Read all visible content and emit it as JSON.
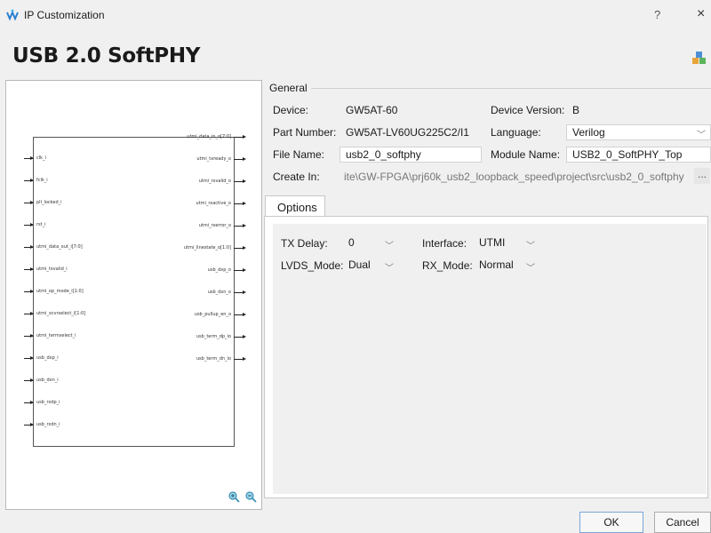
{
  "window": {
    "title": "IP Customization",
    "help": "?",
    "close": "×"
  },
  "ip_name": "USB 2.0 SoftPHY",
  "diagram": {
    "left_ports": [
      "clk_i",
      "fclk_i",
      "pll_locked_i",
      "rst_i",
      "utmi_data_out_i[7:0]",
      "utmi_txvalid_i",
      "utmi_op_mode_i[1:0]",
      "utmi_xcvrselect_i[1:0]",
      "utmi_termselect_i",
      "usb_dxp_i",
      "usb_dxn_i",
      "usb_rxdp_i",
      "usb_rxdn_i"
    ],
    "right_ports": [
      "utmi_data_in_o[7:0]",
      "utmi_txready_o",
      "utmi_rxvalid_o",
      "utmi_rxactive_o",
      "utmi_rxerror_o",
      "utmi_linestate_o[1:0]",
      "usb_dxp_o",
      "usb_dxn_o",
      "usb_pullup_en_o",
      "usb_term_dp_io",
      "usb_term_dn_io"
    ]
  },
  "general": {
    "heading": "General",
    "device_label": "Device:",
    "device": "GW5AT-60",
    "device_version_label": "Device Version:",
    "device_version": "B",
    "part_number_label": "Part Number:",
    "part_number": "GW5AT-LV60UG225C2/I1",
    "language_label": "Language:",
    "language": "Verilog",
    "file_name_label": "File Name:",
    "file_name": "usb2_0_softphy",
    "module_name_label": "Module Name:",
    "module_name": "USB2_0_SoftPHY_Top",
    "create_in_label": "Create In:",
    "create_in": "ite\\GW-FPGA\\prj60k_usb2_loopback_speed\\project\\src\\usb2_0_softphy",
    "browse_label": "..."
  },
  "options": {
    "tab": "Options",
    "tx_delay_label": "TX Delay:",
    "tx_delay": "0",
    "interface_label": "Interface:",
    "interface": "UTMI",
    "lvds_mode_label": "LVDS_Mode:",
    "lvds_mode": "Dual",
    "rx_mode_label": "RX_Mode:",
    "rx_mode": "Normal"
  },
  "buttons": {
    "ok": "OK",
    "cancel": "Cancel"
  }
}
